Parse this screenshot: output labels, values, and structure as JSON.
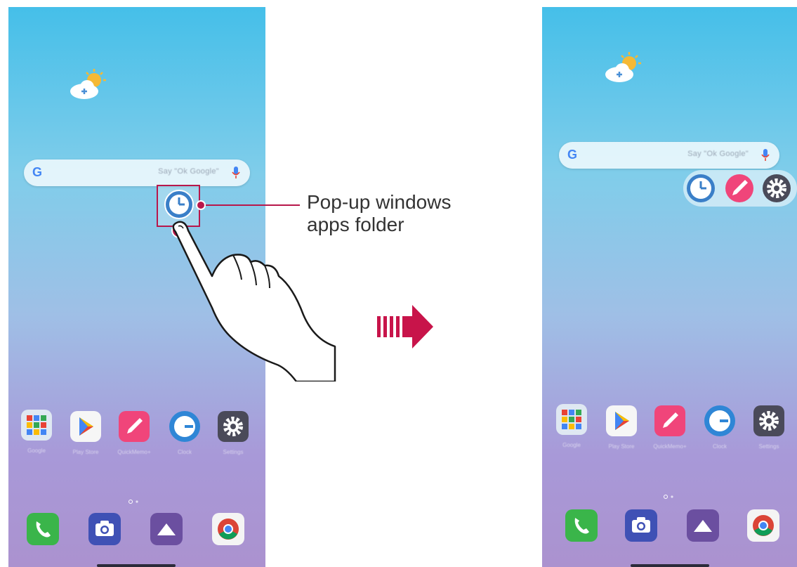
{
  "callout": {
    "line1": "Pop-up windows",
    "line2": "apps folder"
  },
  "search": {
    "hint": "Say \"Ok Google\"",
    "logo": "G"
  },
  "apps": [
    {
      "name": "Google",
      "icon": "google-folder-icon"
    },
    {
      "name": "Play Store",
      "icon": "play-store-icon"
    },
    {
      "name": "QuickMemo+",
      "icon": "quickmemo-icon"
    },
    {
      "name": "Clock",
      "icon": "clock-icon"
    },
    {
      "name": "Settings",
      "icon": "settings-icon"
    }
  ],
  "dock": [
    {
      "icon": "phone-icon"
    },
    {
      "icon": "camera-icon"
    },
    {
      "icon": "gallery-icon"
    },
    {
      "icon": "chrome-icon"
    }
  ],
  "popup_folder": {
    "icons": [
      "clock-icon",
      "quickmemo-icon",
      "settings-icon"
    ]
  },
  "colors": {
    "accent": "#b8174b",
    "wallpaper_top": "#45bfe9",
    "wallpaper_bottom": "#ab92cf"
  }
}
